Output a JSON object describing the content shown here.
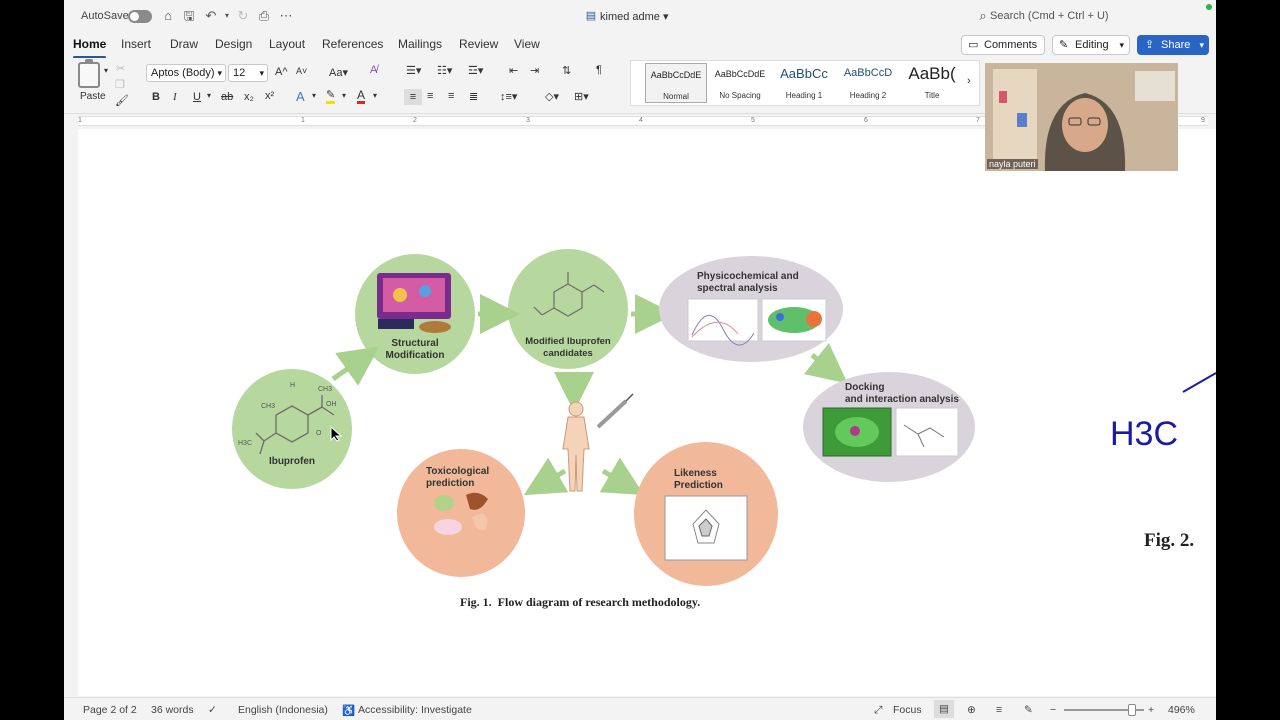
{
  "titlebar": {
    "autosave_label": "AutoSave",
    "document_title": "kimed adme",
    "search_placeholder": "Search (Cmd + Ctrl + U)"
  },
  "ribbon_tabs": [
    "Home",
    "Insert",
    "Draw",
    "Design",
    "Layout",
    "References",
    "Mailings",
    "Review",
    "View"
  ],
  "ribbon_actions": {
    "comments": "Comments",
    "editing": "Editing",
    "share": "Share"
  },
  "toolbar": {
    "paste_label": "Paste",
    "font_name": "Aptos (Body)",
    "font_size": "12",
    "styles": [
      {
        "sample": "AaBbCcDdE",
        "name": "Normal"
      },
      {
        "sample": "AaBbCcDdE",
        "name": "No Spacing"
      },
      {
        "sample": "AaBbCc",
        "name": "Heading 1"
      },
      {
        "sample": "AaBbCcD",
        "name": "Heading 2"
      },
      {
        "sample": "AaBb(",
        "name": "Title"
      }
    ]
  },
  "ruler_numbers": [
    "1",
    "1",
    "2",
    "3",
    "4",
    "5",
    "6",
    "7",
    "9"
  ],
  "figure": {
    "caption": "Fig. 1.  Flow diagram of research methodology.",
    "nodes": {
      "ibuprofen": "Ibuprofen",
      "structural_modification": "Structural Modification",
      "modified_candidates": "Modified Ibuprofen candidates",
      "physicochemical": "Physicochemical and spectral analysis",
      "docking": "Docking and interaction analysis",
      "toxicological": "Toxicological prediction",
      "likeness": "Likeness Prediction"
    },
    "molecule_labels": {
      "ch3": "CH3",
      "h": "H",
      "oh": "OH",
      "o": "O",
      "h3c": "H3C"
    }
  },
  "fig2_partial": {
    "h3c_label": "H3C",
    "caption_fragment": "Fig. 2."
  },
  "video": {
    "participant_name": "nayla puteri"
  },
  "statusbar": {
    "page": "Page 2 of 2",
    "words": "36 words",
    "language": "English (Indonesia)",
    "accessibility": "Accessibility: Investigate",
    "focus": "Focus",
    "zoom": "496%"
  }
}
